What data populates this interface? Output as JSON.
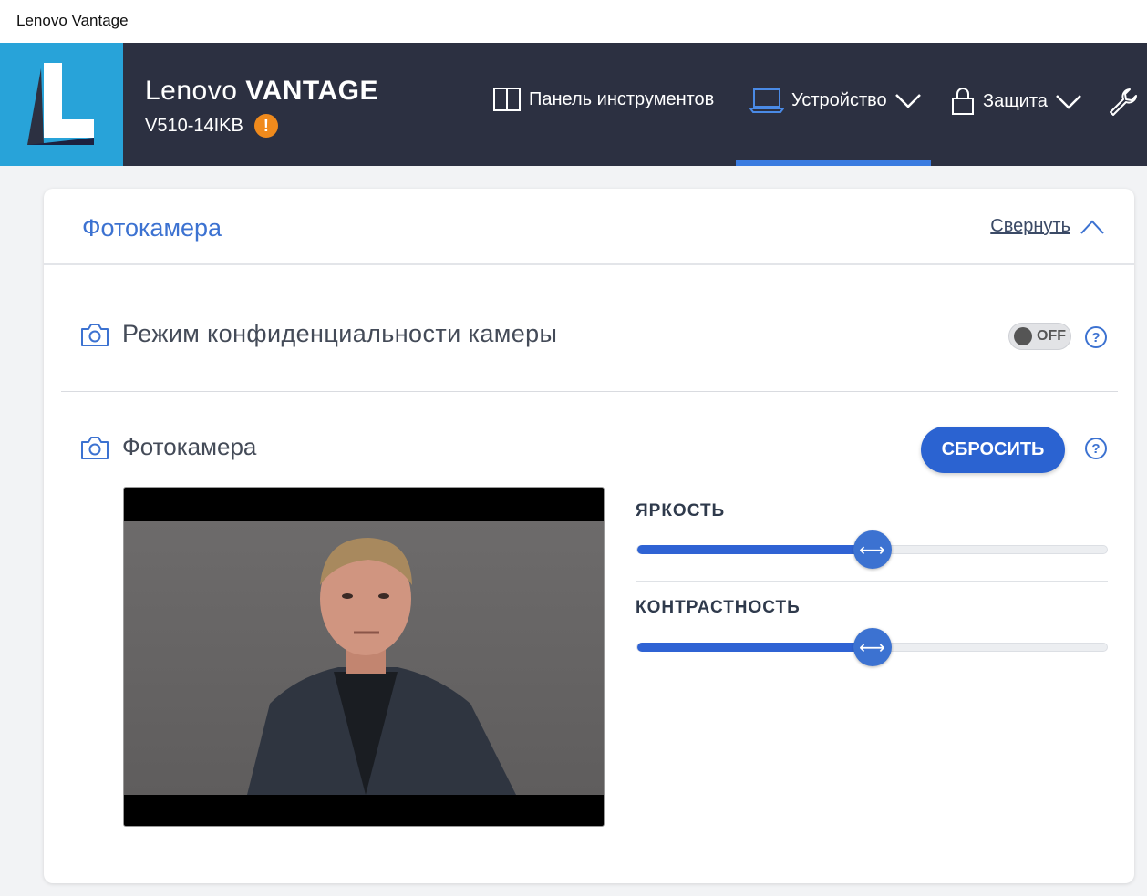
{
  "window": {
    "title": "Lenovo Vantage"
  },
  "header": {
    "brand_prefix": "Lenovo",
    "brand_main": "VANTAGE",
    "model": "V510-14IKB",
    "warning_symbol": "!",
    "logo_letter": "L",
    "nav": [
      {
        "label": "Панель инструментов",
        "icon": "dashboard-icon",
        "active": false
      },
      {
        "label": "Устройство",
        "icon": "laptop-icon",
        "active": true,
        "has_dropdown": true
      },
      {
        "label": "Защита",
        "icon": "lock-icon",
        "active": false,
        "has_dropdown": true
      },
      {
        "label": "",
        "icon": "wrench-icon",
        "active": false
      }
    ],
    "colors": {
      "bg": "#2c3041",
      "logo_bg": "#28a3d9",
      "active_bar": "#3a7be0",
      "warning": "#f08a1c"
    }
  },
  "card": {
    "title": "Фотокамера",
    "collapse_label": "Свернуть",
    "privacy": {
      "label": "Режим конфиденциальности камеры",
      "toggle_text": "OFF",
      "toggle_on": false
    },
    "camera": {
      "label": "Фотокамера",
      "reset_label": "СБРОСИТЬ"
    },
    "sliders": [
      {
        "label": "ЯРКОСТЬ",
        "value_fraction": 0.5
      },
      {
        "label": "КОНТРАСТНОСТЬ",
        "value_fraction": 0.5
      }
    ],
    "help_symbol": "?"
  },
  "colors": {
    "accent": "#3c72d1",
    "button": "#2b63d1"
  }
}
